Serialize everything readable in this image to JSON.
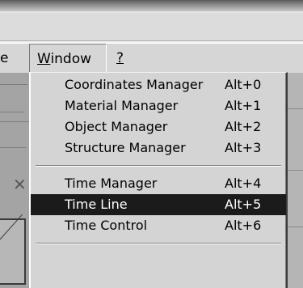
{
  "menubar": {
    "partial_label": "e",
    "window_menu": {
      "accel": "W",
      "rest": "indow"
    },
    "help_menu": "?"
  },
  "window_menu": {
    "group1": [
      {
        "label": "Coordinates Manager",
        "shortcut": "Alt+0"
      },
      {
        "label": "Material Manager",
        "shortcut": "Alt+1"
      },
      {
        "label": "Object Manager",
        "shortcut": "Alt+2"
      },
      {
        "label": "Structure Manager",
        "shortcut": "Alt+3"
      }
    ],
    "group2": [
      {
        "label": "Time Manager",
        "shortcut": "Alt+4"
      },
      {
        "label": "Time Line",
        "shortcut": "Alt+5",
        "selected": true
      },
      {
        "label": "Time Control",
        "shortcut": "Alt+6"
      }
    ]
  },
  "colors": {
    "menu_bg": "#d4d4d4",
    "selected_bg": "#1b1b1b",
    "selected_text": "#ffffff"
  }
}
